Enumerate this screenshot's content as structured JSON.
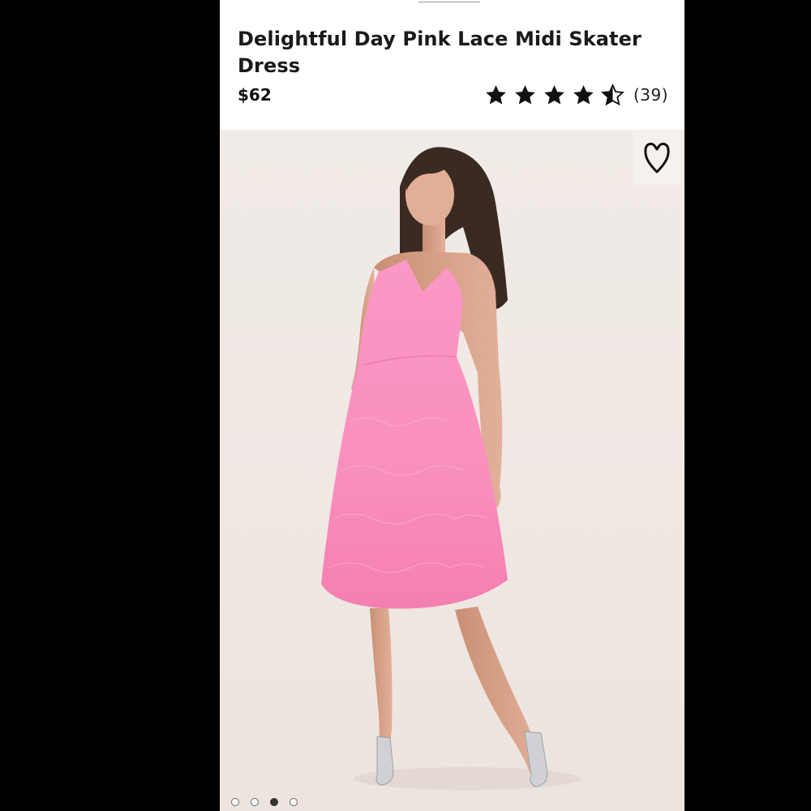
{
  "product": {
    "title": "Delightful Day Pink Lace Midi Skater Dress",
    "price": "$62",
    "rating": 4.5,
    "review_count": "(39)"
  },
  "icons": {
    "favorite": "heart-outline-icon",
    "star_full": "star-icon",
    "star_half": "star-half-icon"
  },
  "carousel": {
    "slides": 4,
    "active_index": 2
  },
  "colors": {
    "dress": "#f691bd",
    "background": "#efe8e3",
    "text": "#1a1a1a"
  }
}
